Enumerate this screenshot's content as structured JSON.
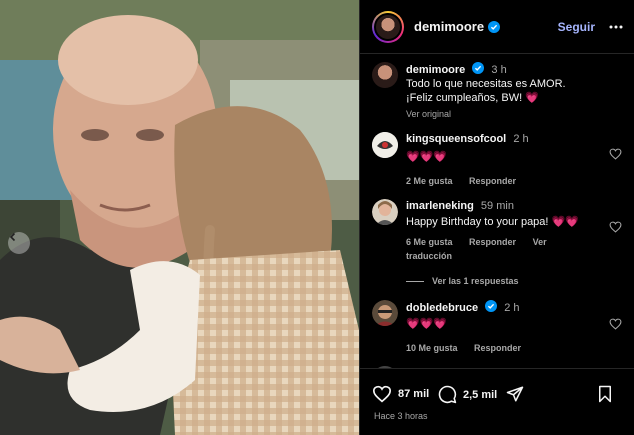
{
  "header": {
    "username": "demimoore",
    "follow_label": "Seguir"
  },
  "caption": {
    "username": "demimoore",
    "time": "3 h",
    "text": "Todo lo que necesitas es AMOR. ¡Feliz cumpleaños, BW! 💗",
    "see_original": "Ver original"
  },
  "comments": [
    {
      "username": "kingsqueensofcool",
      "time": "2 h",
      "text": "💗💗💗",
      "likes": "2 Me gusta",
      "reply": "Responder",
      "translate": ""
    },
    {
      "username": "imarleneking",
      "time": "59 min",
      "text": "Happy Birthday to your papa! 💗💗",
      "likes": "6 Me gusta",
      "reply": "Responder",
      "translate": "Ver traducción"
    },
    {
      "username": "dobledebruce",
      "time": "2 h",
      "text": "💗💗💗",
      "likes": "10 Me gusta",
      "reply": "Responder",
      "translate": ""
    }
  ],
  "replies_label": "Ver las 1 respuestas",
  "actions": {
    "likes_count": "87 mil",
    "comments_count": "2,5 mil",
    "timestamp": "Hace 3 horas"
  },
  "colors": {
    "verified": "#0095f6",
    "follow": "#a5b4fc",
    "heart": "#ff3b6f"
  }
}
